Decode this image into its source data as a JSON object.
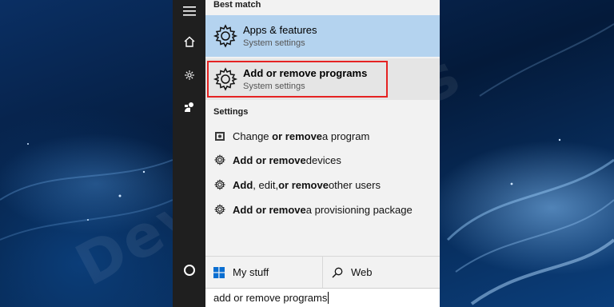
{
  "desktop": {
    "watermark": "DeviceTricks"
  },
  "rail": {
    "icons": [
      "hamburger-icon",
      "home-icon",
      "gear-icon",
      "user-icon",
      "cortana-circle-icon"
    ]
  },
  "best_match": {
    "heading": "Best match",
    "items": [
      {
        "title": "Apps & features",
        "subtitle": "System settings",
        "icon": "gear-icon"
      },
      {
        "title": "Add or remove programs",
        "subtitle": "System settings",
        "icon": "gear-icon"
      }
    ]
  },
  "settings": {
    "heading": "Settings",
    "items": [
      {
        "pre": "Change ",
        "bold": "or remove",
        "post": " a program",
        "icon": "control-panel-icon"
      },
      {
        "pre": "",
        "bold": "Add or remove",
        "post": " devices",
        "icon": "gear-icon"
      },
      {
        "pre": "",
        "bold": "Add",
        "mid": ", edit, ",
        "bold2": "or remove",
        "post": " other users",
        "icon": "gear-icon"
      },
      {
        "pre": "",
        "bold": "Add or remove",
        "post": " a provisioning package",
        "icon": "gear-icon"
      }
    ]
  },
  "tabs": {
    "my_stuff": "My stuff",
    "web": "Web"
  },
  "search": {
    "value": "add or remove programs"
  },
  "colors": {
    "selected": "#b4d3ef",
    "highlight_box": "#e52222",
    "rail": "#1f1f1f",
    "panel": "#f2f2f2"
  }
}
